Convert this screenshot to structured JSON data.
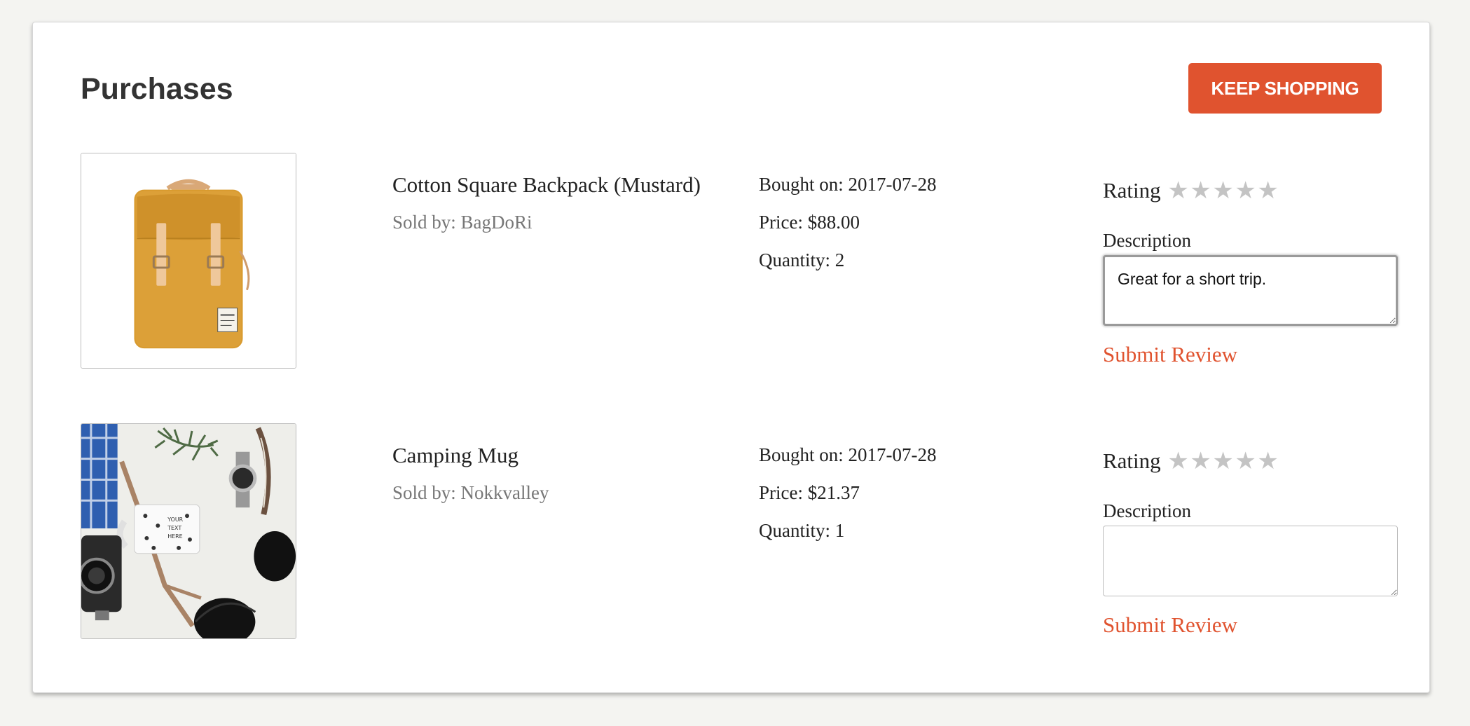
{
  "page": {
    "title": "Purchases",
    "keep_shopping_label": "KEEP SHOPPING"
  },
  "colors": {
    "accent": "#e0532f",
    "star_empty": "#c4c4c4",
    "seller_text": "#777777"
  },
  "purchases": [
    {
      "image_icon": "backpack-photo",
      "name": "Cotton Square Backpack (Mustard)",
      "seller": "Sold by: BagDoRi",
      "bought_on": "Bought on: 2017-07-28",
      "price": "Price: $88.00",
      "quantity": "Quantity: 2",
      "rating_label": "Rating",
      "rating_value": 0,
      "rating_max": 5,
      "description_label": "Description",
      "description_value": "Great for a short trip.",
      "submit_label": "Submit Review"
    },
    {
      "image_icon": "camping-mug-photo",
      "name": "Camping Mug",
      "seller": "Sold by: Nokkvalley",
      "bought_on": "Bought on: 2017-07-28",
      "price": "Price: $21.37",
      "quantity": "Quantity: 1",
      "rating_label": "Rating",
      "rating_value": 0,
      "rating_max": 5,
      "description_label": "Description",
      "description_value": "",
      "submit_label": "Submit Review"
    }
  ]
}
